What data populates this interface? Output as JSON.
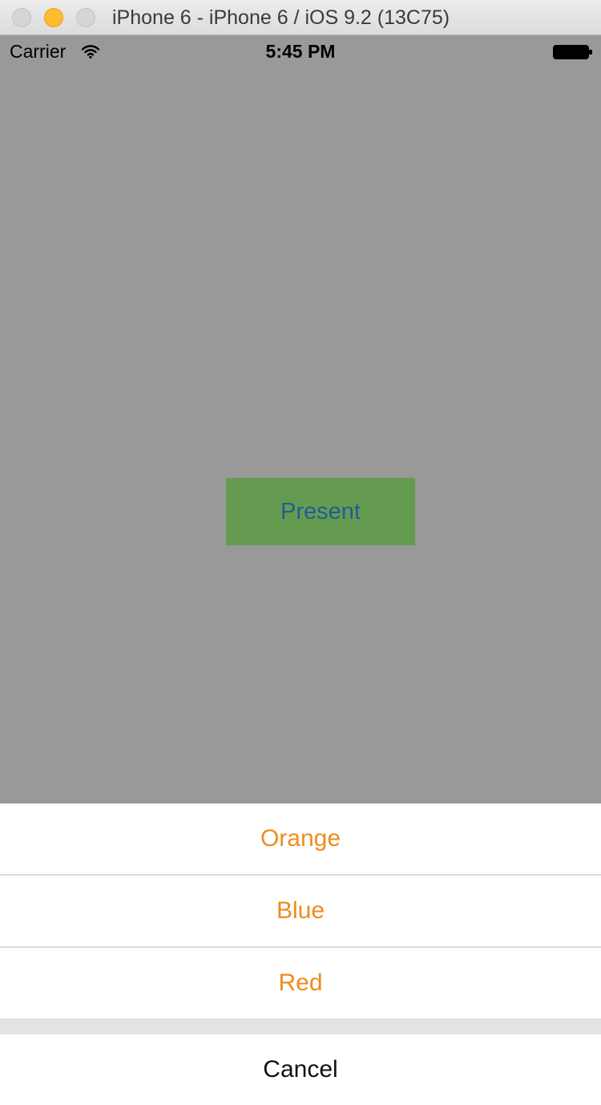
{
  "window": {
    "title": "iPhone 6 - iPhone 6 / iOS 9.2 (13C75)",
    "controls": {
      "close_color": "#d6d6d6",
      "minimize_color": "#febc2e",
      "zoom_color": "#d6d6d6"
    }
  },
  "status_bar": {
    "carrier": "Carrier",
    "time": "5:45 PM",
    "icons": {
      "wifi": "wifi-icon",
      "battery": "battery-icon"
    }
  },
  "main": {
    "background_color": "#999999",
    "present_button": {
      "label": "Present",
      "background_color": "#659b51",
      "text_color": "#1f5e94"
    }
  },
  "action_sheet": {
    "options": [
      {
        "label": "Orange"
      },
      {
        "label": "Blue"
      },
      {
        "label": "Red"
      }
    ],
    "cancel_label": "Cancel",
    "option_text_color": "#ef8c1d"
  }
}
